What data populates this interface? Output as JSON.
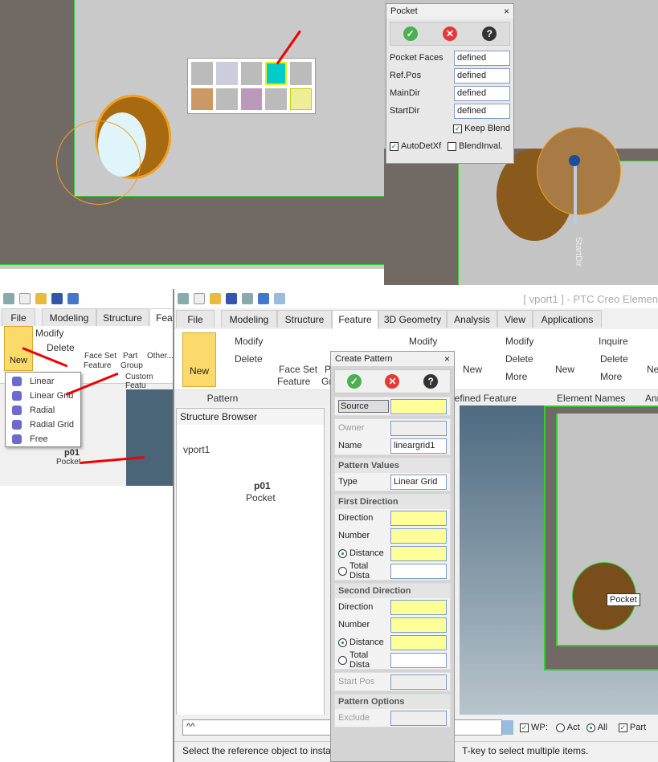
{
  "pocket_dialog": {
    "title": "Pocket",
    "rows": [
      {
        "label": "Pocket Faces",
        "value": "defined"
      },
      {
        "label": "Ref.Pos",
        "value": "defined"
      },
      {
        "label": "MainDir",
        "value": "defined"
      },
      {
        "label": "StartDir",
        "value": "defined"
      }
    ],
    "keep_blend": "Keep Blend",
    "autodetxf": "AutoDetXf",
    "blendinval": "BlendInval.",
    "close": "×"
  },
  "viewport_label": "StartDir",
  "small_panel": {
    "tabs": [
      "File",
      "Modeling",
      "Structure",
      "Feat"
    ],
    "new_label": "New",
    "modify": "Modify",
    "delete": "Delete",
    "face_set": "Face Set",
    "feature": "Feature",
    "part": "Part",
    "group": "Group",
    "other": "Other...",
    "custom": "Custom Featu",
    "menu": [
      "Linear",
      "Linear Grid",
      "Radial",
      "Radial Grid",
      "Free"
    ],
    "tree": {
      "part": "p01",
      "child": "Pocket"
    }
  },
  "main": {
    "title": "[ vport1 ] - PTC Creo Elemen",
    "tabs": [
      "File",
      "Modeling",
      "Structure",
      "Feature",
      "3D Geometry",
      "Analysis",
      "View",
      "Applications"
    ],
    "ribbon": {
      "new": "New",
      "modify": "Modify",
      "delete": "Delete",
      "face_set": "Face Set",
      "feature": "Feature",
      "p": "P",
      "gr": "Gr",
      "modify2": "Modify",
      "new2": "New",
      "modify3": "Modify",
      "delete3": "Delete",
      "more": "More",
      "new4": "New",
      "inquire": "Inquire",
      "delete4": "Delete",
      "more4": "More",
      "ne": "Ne",
      "groups": [
        "Pattern",
        "ser Defined Feature",
        "Element Names",
        "Anr"
      ]
    },
    "structure_browser": {
      "title": "Structure Browser",
      "root": "vport1",
      "part": "p01",
      "child": "Pocket"
    },
    "command_input": "^^",
    "wp": "WP:",
    "act": "Act",
    "all": "All",
    "part": "Part",
    "status": "Select the reference object to insta",
    "status2": "T-key to select multiple items.",
    "tooltip": "Pocket"
  },
  "create_pattern": {
    "title": "Create Pattern",
    "source": "Source",
    "owner": "Owner",
    "name_label": "Name",
    "name_value": "lineargrid1",
    "pattern_values": "Pattern Values",
    "type_label": "Type",
    "type_value": "Linear Grid",
    "first": {
      "title": "First Direction",
      "direction": "Direction",
      "number": "Number",
      "distance": "Distance",
      "total": "Total Dista"
    },
    "second": {
      "title": "Second Direction",
      "direction": "Direction",
      "number": "Number",
      "distance": "Distance",
      "total": "Total Dista"
    },
    "start_pos": "Start Pos",
    "pattern_options": "Pattern Options",
    "exclude": "Exclude"
  },
  "colors": {
    "accent": "#ffff99",
    "arrow": "#e00000",
    "edge": "#33cc33"
  }
}
